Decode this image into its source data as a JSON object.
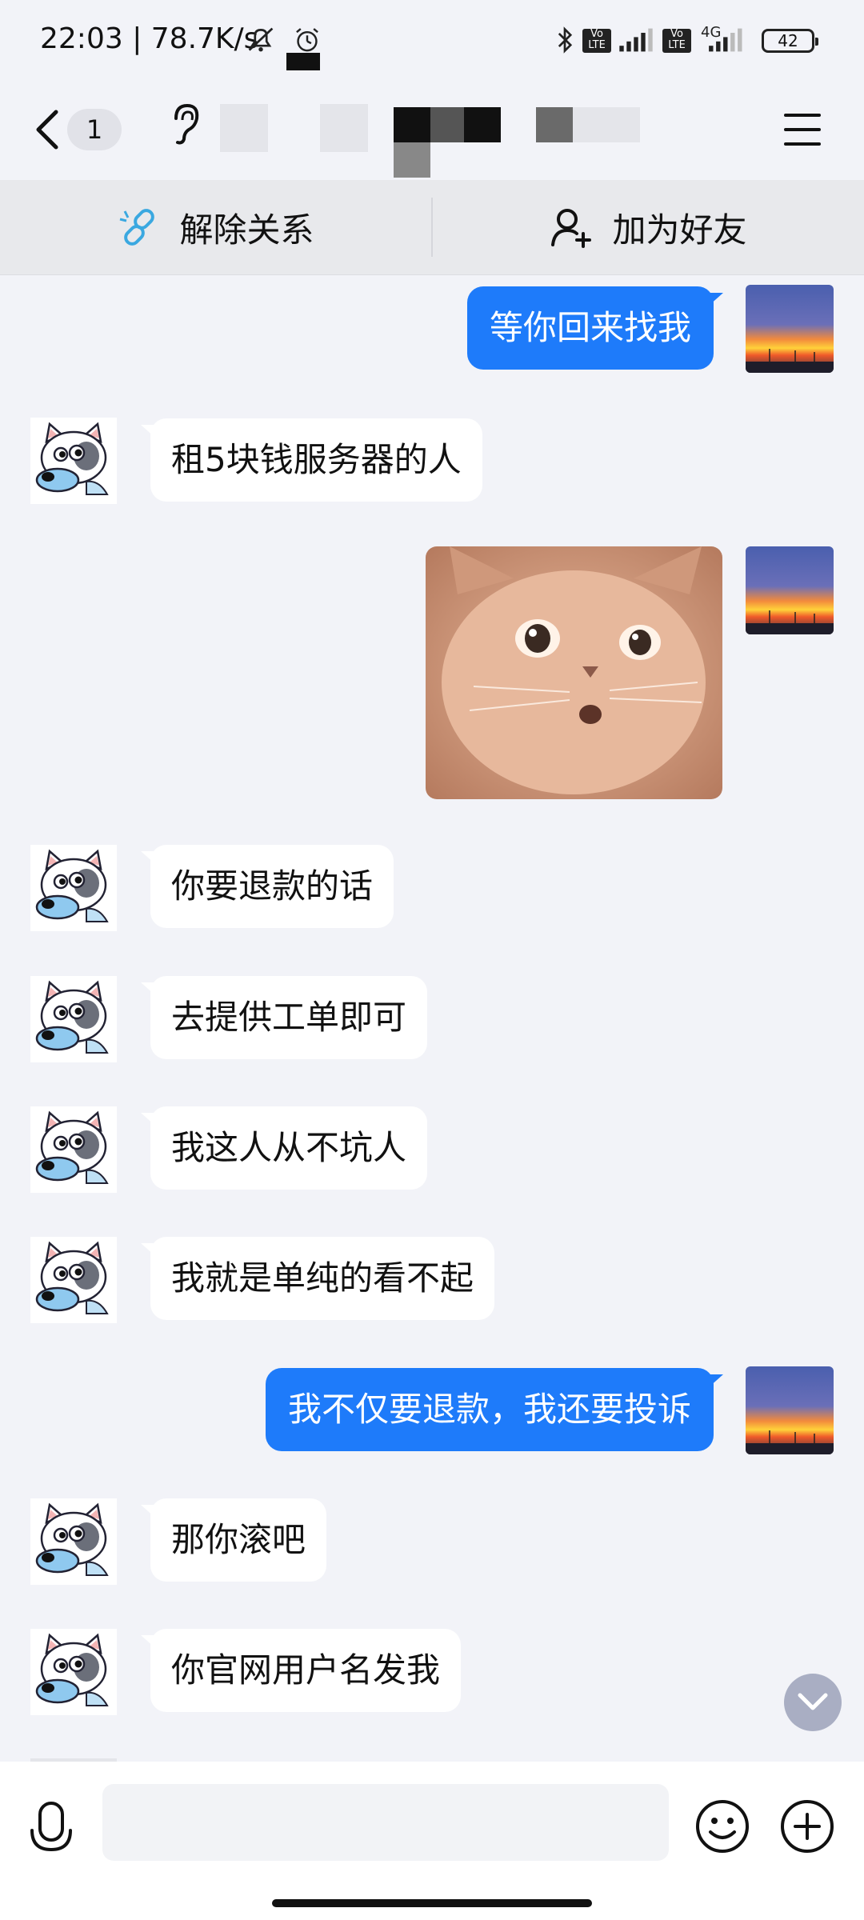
{
  "status_bar": {
    "time": "22:03",
    "speed": "78.7K/s",
    "network_label": "4G",
    "battery": "42"
  },
  "header": {
    "unread_count": "1"
  },
  "actions": {
    "unlink_label": "解除关系",
    "add_friend_label": "加为好友"
  },
  "messages": [
    {
      "from": "me",
      "text": "等你回来找我"
    },
    {
      "from": "other",
      "text": "租5块钱服务器的人"
    },
    {
      "from": "me",
      "type": "sticker",
      "sticker": "surprised-cat"
    },
    {
      "from": "other",
      "text": "你要退款的话"
    },
    {
      "from": "other",
      "text": "去提供工单即可"
    },
    {
      "from": "other",
      "text": "我这人从不坑人"
    },
    {
      "from": "other",
      "text": "我就是单纯的看不起"
    },
    {
      "from": "me",
      "text": "我不仅要退款，我还要投诉"
    },
    {
      "from": "other",
      "text": "那你滚吧"
    },
    {
      "from": "other",
      "text": "你官网用户名发我"
    }
  ],
  "input": {
    "placeholder": ""
  },
  "colors": {
    "accent": "#1e7bfa",
    "background": "#f2f3f8",
    "bubble_other": "#ffffff"
  }
}
